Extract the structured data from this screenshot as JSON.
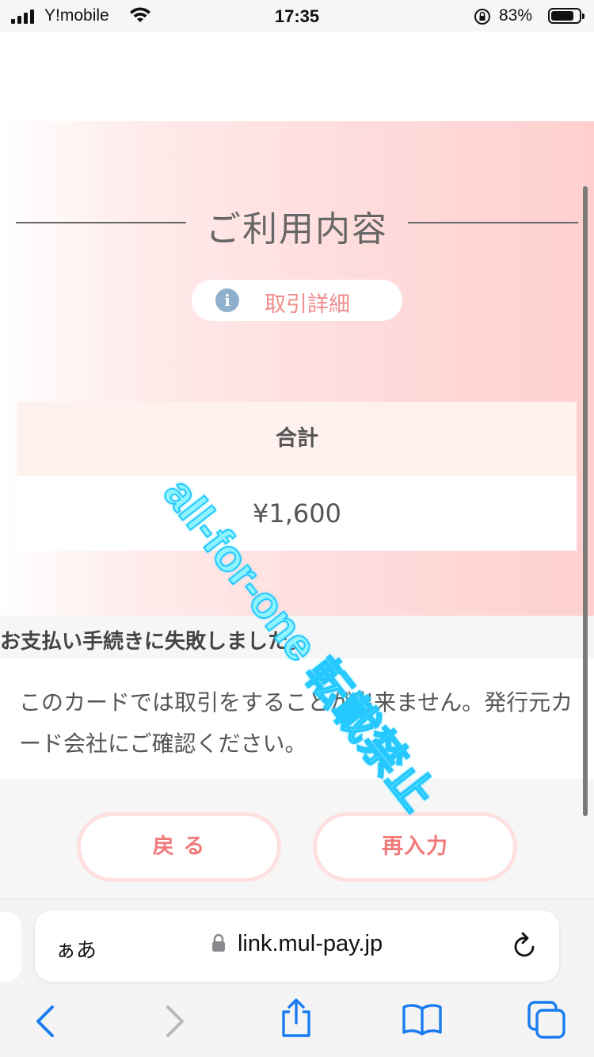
{
  "status_bar": {
    "carrier": "Y!mobile",
    "time": "17:35",
    "battery_percent": "83%",
    "battery_level": 0.83
  },
  "main": {
    "title": "ご利用内容",
    "detail_button": "取引詳細",
    "total_label": "合計",
    "total_value": "¥1,600"
  },
  "error": {
    "title": "お支払い手続きに失敗しました。",
    "message": "このカードでは取引をすることが出来ません。発行元カード会社にご確認ください。"
  },
  "buttons": {
    "back": "戻 る",
    "reenter": "再入力"
  },
  "watermark": "all-for-one 転載禁止",
  "browser": {
    "aa_label": "ぁあ",
    "url": "link.mul-pay.jp"
  },
  "colors": {
    "accent_pink": "#f07a7a",
    "info_blue": "#8fb0cc",
    "watermark_cyan": "#8ef3ff",
    "ios_blue": "#1a7cf0"
  },
  "icons": [
    "signal-icon",
    "wifi-icon",
    "orientation-lock-icon",
    "battery-icon",
    "info-icon",
    "lock-icon",
    "reload-icon",
    "back-arrow-icon",
    "forward-arrow-icon",
    "share-icon",
    "bookmarks-icon",
    "tabs-icon"
  ]
}
